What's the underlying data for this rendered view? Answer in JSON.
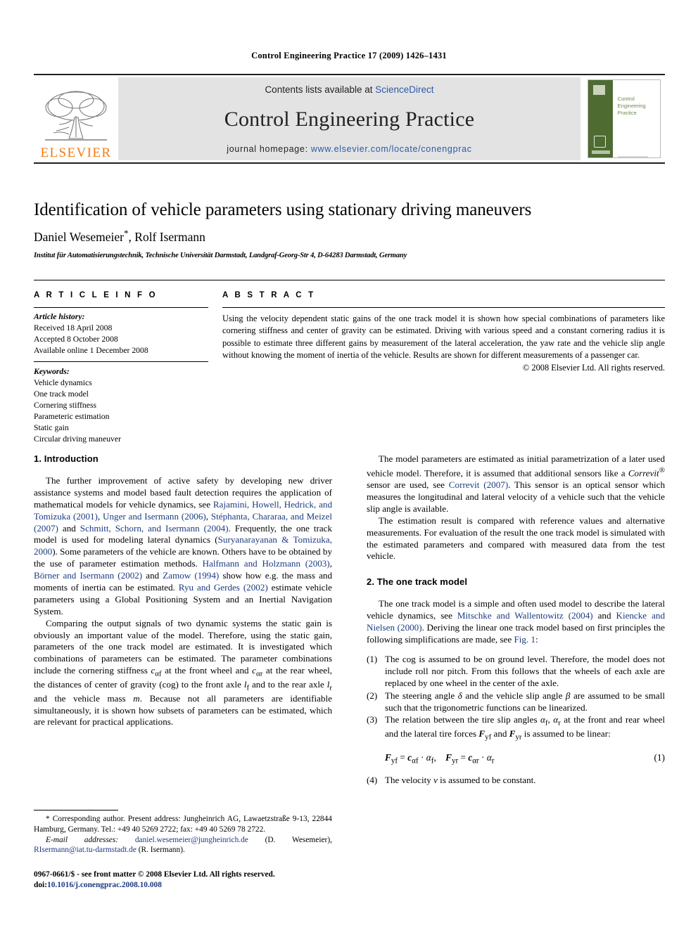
{
  "running_head": "Control Engineering Practice 17 (2009) 1426–1431",
  "banner": {
    "publisher_wordmark": "ELSEVIER",
    "contents_prefix": "Contents lists available at ",
    "contents_link": "ScienceDirect",
    "journal_title": "Control Engineering Practice",
    "homepage_prefix": "journal homepage: ",
    "homepage_url": "www.elsevier.com/locate/conengprac",
    "cover_title": "Control\nEngineering\nPractice"
  },
  "article": {
    "title": "Identification of vehicle parameters using stationary driving maneuvers",
    "authors": "Daniel Wesemeier",
    "authors_marker": "*",
    "authors_rest": ", Rolf Isermann",
    "affiliation": "Institut für Automatisierungstechnik, Technische Universität Darmstadt, Landgraf-Georg-Str 4, D-64283 Darmstadt, Germany"
  },
  "info": {
    "heading": "A R T I C L E   I N F O",
    "history_label": "Article history:",
    "history": [
      "Received 18 April 2008",
      "Accepted 8 October 2008",
      "Available online 1 December 2008"
    ],
    "keywords_label": "Keywords:",
    "keywords": [
      "Vehicle dynamics",
      "One track model",
      "Cornering stiffness",
      "Parameteric estimation",
      "Static gain",
      "Circular driving maneuver"
    ]
  },
  "abstract": {
    "heading": "A B S T R A C T",
    "text": "Using the velocity dependent static gains of the one track model it is shown how special combinations of parameters like cornering stiffness and center of gravity can be estimated. Driving with various speed and a constant cornering radius it is possible to estimate three different gains by measurement of the lateral acceleration, the yaw rate and the vehicle slip angle without knowing the moment of inertia of the vehicle. Results are shown for different measurements of a passenger car.",
    "copyright": "© 2008 Elsevier Ltd. All rights reserved."
  },
  "sections": {
    "intro_heading": "1.  Introduction",
    "intro_p1_a": "The further improvement of active safety by developing new driver assistance systems and model based fault detection requires the application of mathematical models for vehicle dynamics, see ",
    "intro_p1_c1": "Rajamini, Howell, Hedrick, and Tomizuka (2001)",
    "intro_p1_b": ", ",
    "intro_p1_c2": "Unger and Isermann (2006)",
    "intro_p1_c3": "Stéphanta, Chararaa, and Meizel (2007)",
    "intro_p1_d": " and ",
    "intro_p1_c4": "Schmitt, Schorn, and Isermann (2004)",
    "intro_p1_e": ". Frequently, the one track model is used for modeling lateral dynamics (",
    "intro_p1_c5": "Suryanarayanan & Tomizuka, 2000",
    "intro_p1_f": "). Some parameters of the vehicle are known. Others have to be obtained by the use of parameter estimation methods. ",
    "intro_p1_c6": "Halfmann and Holzmann (2003)",
    "intro_p1_c7": "Börner and Isermann (2002)",
    "intro_p1_c8": "Zamow (1994)",
    "intro_p1_g": " show how e.g. the mass and moments of inertia can be estimated. ",
    "intro_p1_c9": "Ryu and Gerdes (2002)",
    "intro_p1_h": " estimate vehicle parameters using a Global Positioning System and an Inertial Navigation System.",
    "intro_p2_a": "Comparing the output signals of two dynamic systems the static gain is obviously an important value of the model. Therefore, using the static gain, parameters of the one track model are estimated. It is investigated which combinations of parameters can be estimated. The parameter combinations include the cornering stiffness ",
    "intro_p2_sym1": "c",
    "intro_p2_sub1": "αf",
    "intro_p2_b": " at the front wheel and ",
    "intro_p2_sym2": "c",
    "intro_p2_sub2": "αr",
    "intro_p2_c": " at the rear wheel, the distances of center of gravity (cog) to the front axle ",
    "intro_p2_sym3": "l",
    "intro_p2_sub3": "f",
    "intro_p2_d": " and to the rear axle ",
    "intro_p2_sym4": "l",
    "intro_p2_sub4": "r",
    "intro_p2_e": " and the vehicle mass ",
    "intro_p2_sym5": "m",
    "intro_p2_f": ". Because not all parameters are identifiable simultaneously, it is shown how subsets of parameters can be estimated, which are relevant for practical applications.",
    "right_p1_a": "The model parameters are estimated as initial parametrization of a later used vehicle model. Therefore, it is assumed that additional sensors like a ",
    "right_p1_prod": "Correvit",
    "right_p1_sup": "®",
    "right_p1_b": " sensor are used, see ",
    "right_p1_c1": "Correvit (2007)",
    "right_p1_c": ". This sensor is an optical sensor which measures the longitudinal and lateral velocity of a vehicle such that the vehicle slip angle is available.",
    "right_p2": "The estimation result is compared with reference values and alternative measurements. For evaluation of the result the one track model is simulated with the estimated parameters and compared with measured data from the test vehicle.",
    "model_heading": "2.  The one track model",
    "model_p1_a": "The one track model is a simple and often used model to describe the lateral vehicle dynamics, see ",
    "model_p1_c1": "Mitschke and Wallentowitz (2004)",
    "model_p1_b": " and ",
    "model_p1_c2": "Kiencke and Nielsen (2000)",
    "model_p1_c": ". Deriving the linear one track model based on first principles the following simplifications are made, see ",
    "model_p1_fig": "Fig. 1",
    "model_p1_d": ":"
  },
  "list": [
    {
      "num": "(1)",
      "text": "The cog is assumed to be on ground level. Therefore, the model does not include roll nor pitch. From this follows that the wheels of each axle are replaced by one wheel in the center of the axle."
    },
    {
      "num": "(2)",
      "text_a": "The steering angle ",
      "sym1": "δ",
      "text_b": " and the vehicle slip angle ",
      "sym2": "β",
      "text_c": " are assumed to be small such that the trigonometric functions can be linearized."
    },
    {
      "num": "(3)",
      "text_a": "The relation between the tire slip angles ",
      "sym1": "α",
      "sub1": "f",
      "text_b": ", ",
      "sym2": "α",
      "sub2": "r",
      "text_c": " at the front and rear wheel and the lateral tire forces ",
      "sym3": "F",
      "sub3": "yf",
      "text_d": " and ",
      "sym4": "F",
      "sub4": "yr",
      "text_e": " is assumed to be linear:"
    },
    {
      "num": "(4)",
      "text_a": "The velocity ",
      "sym1": "v",
      "text_b": " is assumed to be constant."
    }
  ],
  "equation": {
    "lhs1": "F",
    "lhs1_sub": "yf",
    "eq1": " = ",
    "rhs1": "c",
    "rhs1_sub": "αf",
    "dot1": " · ",
    "alpha1": "α",
    "alpha1_sub": "f",
    "comma": ",",
    "lhs2": "F",
    "lhs2_sub": "yr",
    "eq2": " = ",
    "rhs2": "c",
    "rhs2_sub": "αr",
    "dot2": " · ",
    "alpha2": "α",
    "alpha2_sub": "r",
    "number": "(1)"
  },
  "footnote": {
    "marker": "*",
    "corresponding": " Corresponding author. Present address: Jungheinrich AG, Lawaetzstraße 9-13, 22844 Hamburg, Germany. Tel.: +49 40 5269 2722; fax: +49 40 5269 78 2722.",
    "email_label": "E-mail addresses:",
    "email1": "daniel.wesemeier@jungheinrich.de",
    "email1_name": " (D. Wesemeier),",
    "email2": "RIsermann@iat.tu-darmstadt.de",
    "email2_name": " (R. Isermann).",
    "issn_line": "0967-0661/$ - see front matter © 2008 Elsevier Ltd. All rights reserved.",
    "doi_label": "doi:",
    "doi": "10.1016/j.conengprac.2008.10.008"
  }
}
